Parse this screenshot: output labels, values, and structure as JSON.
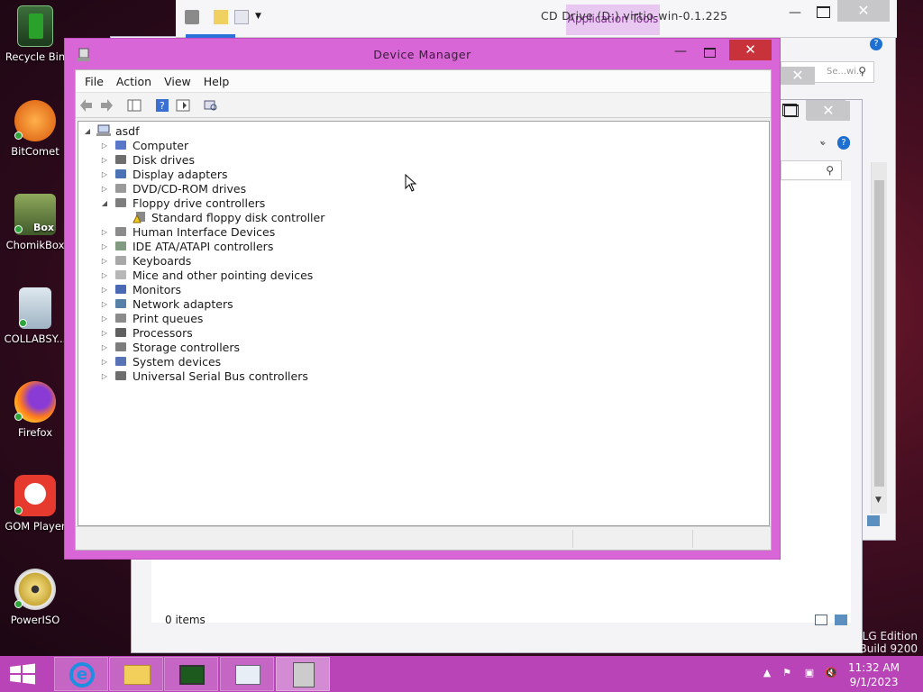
{
  "desktop_icons": [
    {
      "label": "Recycle Bin",
      "icon": "recycle-bin-icon"
    },
    {
      "label": "BitComet",
      "icon": "bitcomet-icon"
    },
    {
      "label": "ChomikBox",
      "icon": "chomikbox-icon"
    },
    {
      "label": "COLLABSY...",
      "icon": "collabsy-icon"
    },
    {
      "label": "Firefox",
      "icon": "firefox-icon"
    },
    {
      "label": "GOM Player",
      "icon": "gom-player-icon"
    },
    {
      "label": "PowerISO",
      "icon": "poweriso-icon"
    }
  ],
  "explorer": {
    "ribbon_tab": "Application Tools",
    "title": "CD Drive (D:) virtio-win-0.1.225",
    "search_placeholder": "Se...wi...",
    "status_items": "0 items"
  },
  "device_manager": {
    "title": "Device Manager",
    "menu": [
      "File",
      "Action",
      "View",
      "Help"
    ],
    "root": "asdf",
    "nodes": [
      {
        "label": "Computer",
        "icon": "computer-icon",
        "expanded": false
      },
      {
        "label": "Disk drives",
        "icon": "disk-drive-icon",
        "expanded": false
      },
      {
        "label": "Display adapters",
        "icon": "display-adapter-icon",
        "expanded": false
      },
      {
        "label": "DVD/CD-ROM drives",
        "icon": "dvd-drive-icon",
        "expanded": false
      },
      {
        "label": "Floppy drive controllers",
        "icon": "floppy-controller-icon",
        "expanded": true,
        "children": [
          {
            "label": "Standard floppy disk controller",
            "icon": "floppy-warning-icon"
          }
        ]
      },
      {
        "label": "Human Interface Devices",
        "icon": "hid-icon",
        "expanded": false
      },
      {
        "label": "IDE ATA/ATAPI controllers",
        "icon": "ide-controller-icon",
        "expanded": false
      },
      {
        "label": "Keyboards",
        "icon": "keyboard-icon",
        "expanded": false
      },
      {
        "label": "Mice and other pointing devices",
        "icon": "mouse-icon",
        "expanded": false
      },
      {
        "label": "Monitors",
        "icon": "monitor-icon",
        "expanded": false
      },
      {
        "label": "Network adapters",
        "icon": "network-adapter-icon",
        "expanded": false
      },
      {
        "label": "Print queues",
        "icon": "printer-icon",
        "expanded": false
      },
      {
        "label": "Processors",
        "icon": "processor-icon",
        "expanded": false
      },
      {
        "label": "Storage controllers",
        "icon": "storage-controller-icon",
        "expanded": false
      },
      {
        "label": "System devices",
        "icon": "system-devices-icon",
        "expanded": false
      },
      {
        "label": "Universal Serial Bus controllers",
        "icon": "usb-icon",
        "expanded": false
      }
    ]
  },
  "taskbar": {
    "time": "11:32 AM",
    "date": "9/1/2023"
  },
  "watermark": {
    "line1": "LG Edition",
    "line2": "Build 9200"
  },
  "colors": {
    "accent": "#d966d6",
    "taskbar": "#b944b8",
    "close": "#c7323b"
  }
}
